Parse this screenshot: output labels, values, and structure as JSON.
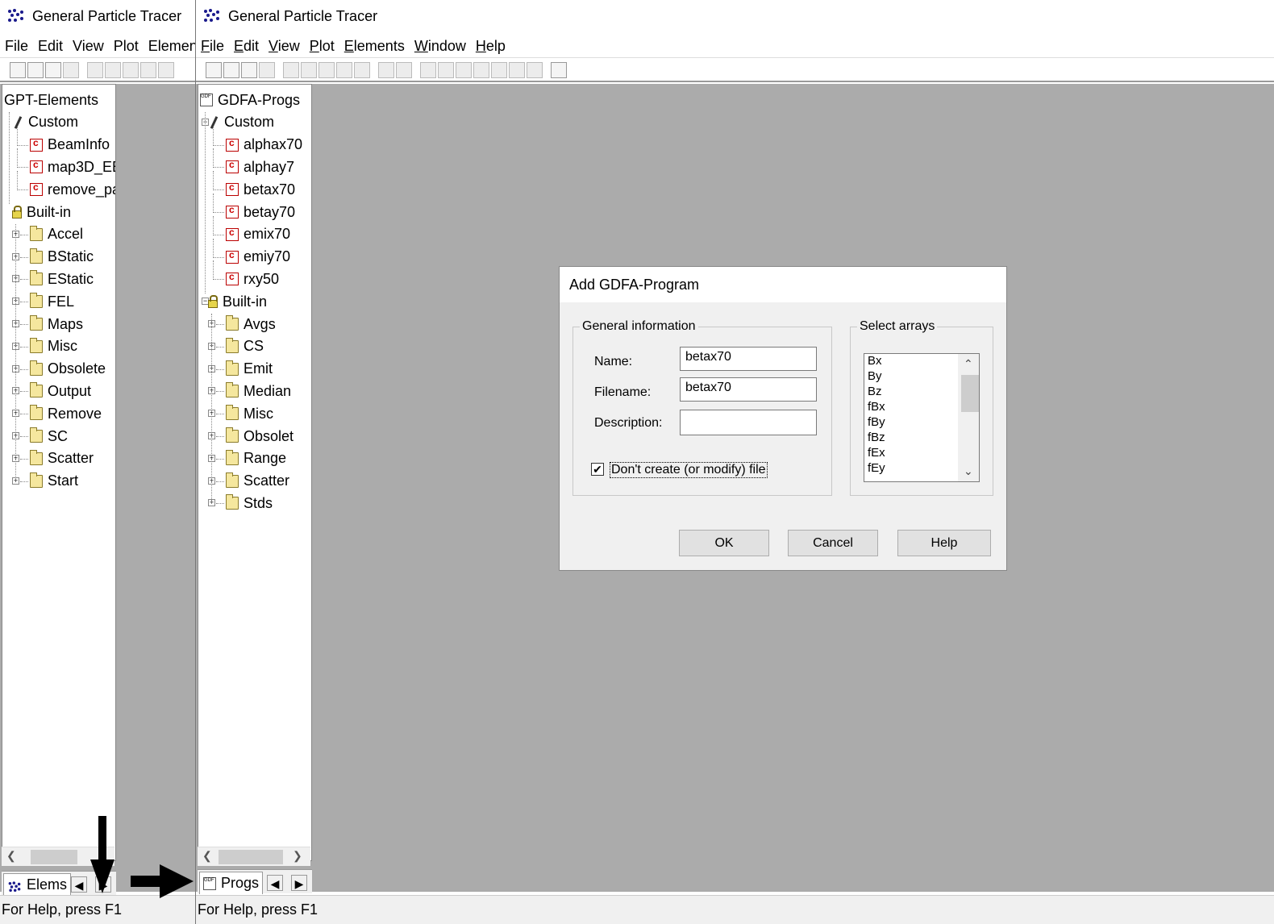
{
  "app": {
    "title": "General Particle Tracer"
  },
  "left_window": {
    "menu": [
      "File",
      "Edit",
      "View",
      "Plot",
      "Elemen"
    ],
    "tree_root": "GPT-Elements",
    "custom_label": "Custom",
    "custom_items": [
      "BeamInfo",
      "map3D_EB",
      "remove_pa"
    ],
    "builtin_label": "Built-in",
    "builtin_items": [
      "Accel",
      "BStatic",
      "EStatic",
      "FEL",
      "Maps",
      "Misc",
      "Obsolete",
      "Output",
      "Remove",
      "SC",
      "Scatter",
      "Start"
    ],
    "tab_label": "Elems",
    "status": "For Help, press F1"
  },
  "right_window": {
    "menu": [
      "File",
      "Edit",
      "View",
      "Plot",
      "Elements",
      "Window",
      "Help"
    ],
    "tree_root": "GDFA-Progs",
    "custom_label": "Custom",
    "custom_items": [
      "alphax70",
      "alphay7",
      "betax70",
      "betay70",
      "emix70",
      "emiy70",
      "rxy50"
    ],
    "builtin_label": "Built-in",
    "builtin_items": [
      "Avgs",
      "CS",
      "Emit",
      "Median",
      "Misc",
      "Obsolet",
      "Range",
      "Scatter",
      "Stds"
    ],
    "tab_label": "Progs",
    "status": "For Help, press F1"
  },
  "dialog": {
    "title": "Add GDFA-Program",
    "general_group": "General information",
    "name_label": "Name:",
    "name_value": "betax70",
    "filename_label": "Filename:",
    "filename_value": "betax70",
    "description_label": "Description:",
    "description_value": "",
    "checkbox_label": "Don't create (or modify) file",
    "checkbox_checked": true,
    "arrays_group": "Select arrays",
    "arrays": [
      "Bx",
      "By",
      "Bz",
      "fBx",
      "fBy",
      "fBz",
      "fEx",
      "fEy"
    ],
    "ok": "OK",
    "cancel": "Cancel",
    "help": "Help"
  }
}
